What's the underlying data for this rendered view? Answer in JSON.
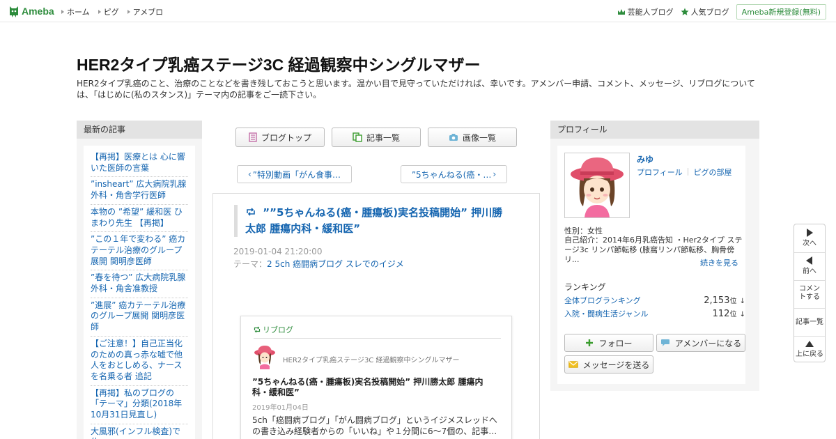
{
  "header": {
    "logo": "Ameba",
    "nav": [
      "ホーム",
      "ピグ",
      "アメブロ"
    ],
    "links": [
      "芸能人ブログ",
      "人気ブログ"
    ],
    "register": "Ameba新規登録(無料)"
  },
  "blog": {
    "title": "HER2タイプ乳癌ステージ3C 経過観察中シングルマザー",
    "description": "HER2タイプ乳癌のこと、治療のことなどを書き残しておこうと思います。温かい目で見守っていただければ、幸いです。アメンバー申請、コメント、メッセージ、リブログについては、「はじめに(私のスタンス)」テーマ内の記事をご一読下さい。"
  },
  "recent": {
    "title": "最新の記事",
    "items": [
      "【再掲】医療とは 心に響いた医師の言葉",
      "”insheart” 広大病院乳腺外科・角舎学行医師",
      "本物の ”希望” 緩和医 ひまわり先生 【再掲】",
      "”この１年で変わる” 癌カテーテル治療のグループ展開 関明彦医師",
      "”春を待つ” 広大病院乳腺外科・角舎准教授",
      "”進展” 癌カテーテル治療のグループ展開 関明彦医師",
      "【ご注意！】自己正当化のための真っ赤な嘘で他人をおとしめる、ナースを名乗る者 追記",
      "【再掲】私のブログの「テーマ」分類(2018年10月31日見直し)",
      "大風邪(インフル検査)で休"
    ]
  },
  "tabs": [
    "ブログトップ",
    "記事一覧",
    "画像一覧"
  ],
  "pager": {
    "prev": "”特別動画「がん食事…",
    "next": "”5ちゃんねる(癌・…"
  },
  "article": {
    "title": "””5ちゃんねる(癌・腫瘍板)実名投稿開始” 押川勝太郎 腫瘍内科・緩和医”",
    "date": "2019-01-04 21:20:00",
    "theme_label": "テーマ：",
    "theme": "2 5ch 癌闘病ブログ スレでのイジメ"
  },
  "reblog": {
    "label": "リブログ",
    "blog_name": "HER2タイプ乳癌ステージ3C 経過観察中シングルマザー",
    "title": "”5ちゃんねる(癌・腫瘍板)実名投稿開始” 押川勝太郎 腫瘍内科・緩和医”",
    "date": "2019年01月04日",
    "excerpt": "5ch「癌闘病ブログ」「がん闘病ブログ」というイジメスレッドへの書き込み経験者からの「いいね」や１分間に6～7個の、記事…"
  },
  "profile": {
    "title": "プロフィール",
    "name": "みゆ",
    "link1": "プロフィール",
    "link2": "ピグの部屋",
    "sex": "性別：女性",
    "intro": "自己紹介：2014年6月乳癌告知 ・Her2タイプ ステージ3c リンパ節転移 (腋窩リンパ節転移、胸骨傍リ...",
    "more": "続きを見る",
    "ranking_title": "ランキング",
    "ranking": [
      {
        "label": "全体ブログランキング",
        "value": "2,153",
        "unit": "位",
        "arrow": "↓"
      },
      {
        "label": "入院・闘病生活ジャンル",
        "value": "112",
        "unit": "位",
        "arrow": "↓"
      }
    ],
    "follow": "フォロー",
    "amember": "アメンバーになる",
    "message": "メッセージを送る"
  },
  "sidefloat": {
    "next": "次へ",
    "prev": "前へ",
    "comment": "コメントする",
    "list": "記事一覧",
    "top": "上に戻る"
  }
}
